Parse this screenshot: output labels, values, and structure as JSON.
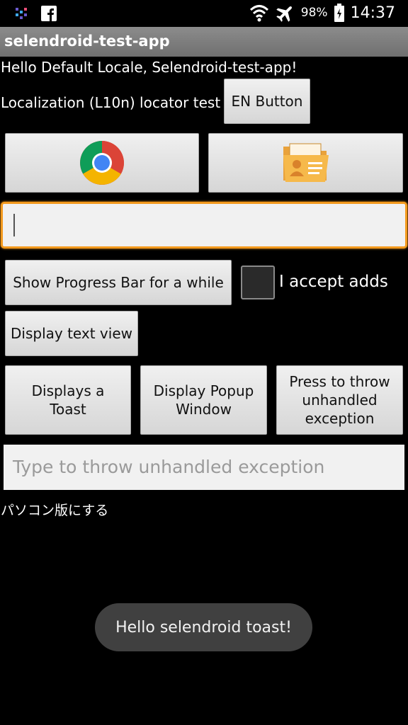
{
  "status_bar": {
    "battery_percent": "98%",
    "time": "14:37",
    "icons": [
      "app-notification-icon",
      "facebook-icon",
      "wifi-icon",
      "airplane-mode-icon",
      "battery-icon"
    ]
  },
  "action_bar": {
    "title": "selendroid-test-app"
  },
  "main": {
    "hello_text": "Hello Default Locale, Selendroid-test-app!",
    "localization_text": "Localization (L10n) locator test",
    "en_button": "EN Button",
    "chrome_button_icon": "chrome-icon",
    "contacts_button_icon": "contacts-folder-icon",
    "text_input": {
      "value": "",
      "placeholder": ""
    },
    "progress_button": "Show Progress Bar for a while",
    "accept_checkbox": {
      "label": "I accept adds",
      "checked": false
    },
    "display_text_view_button": "Display text view",
    "toast_button": {
      "line1": "Displays a",
      "line2": "Toast"
    },
    "popup_button": {
      "line1": "Display Popup",
      "line2": "Window"
    },
    "exception_button": {
      "line1": "Press to throw",
      "line2": "unhandled",
      "line3": "exception"
    },
    "exception_input": {
      "value": "",
      "placeholder": "Type to throw unhandled exception"
    },
    "japanese_text": "パソコン版にする"
  },
  "toast": {
    "message": "Hello selendroid toast!"
  },
  "colors": {
    "focus_accent": "#f39a1e",
    "action_bar": "#7d7d7d",
    "background": "#000000"
  }
}
